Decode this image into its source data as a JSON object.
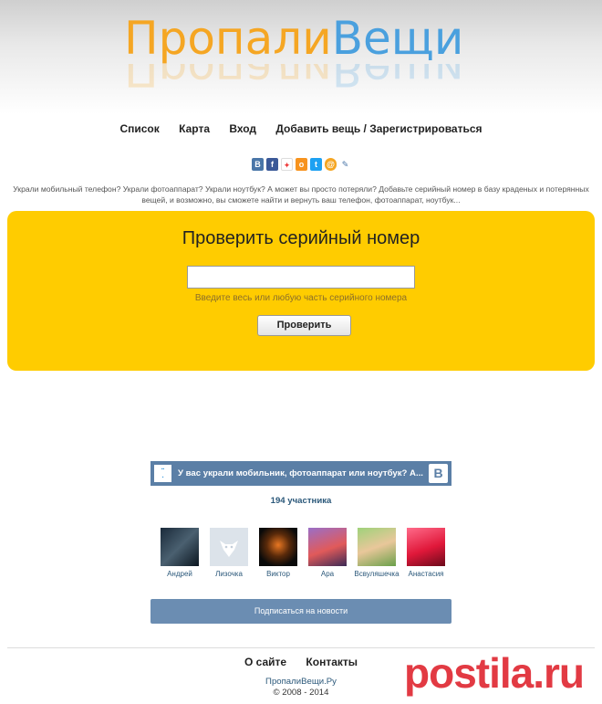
{
  "logo": {
    "part1": "Пропали",
    "part2": "Вещи"
  },
  "nav": {
    "list": "Список",
    "map": "Карта",
    "login": "Вход",
    "register": "Добавить вещь / Зарегистрироваться"
  },
  "share": {
    "icons": [
      "vk-icon",
      "facebook-icon",
      "odnoklassniki-icon",
      "livejournal-icon",
      "twitter-icon",
      "mailru-icon",
      "pencil-icon"
    ],
    "colors": [
      "#4a76a8",
      "#3b5998",
      "#f7931e",
      "#ee8208",
      "#1da1f2",
      "#168de2",
      "#7a9ec7"
    ]
  },
  "intro_text": "Украли мобильный телефон? Украли фотоаппарат? Украли ноутбук? А может вы просто потеряли? Добавьте серийный номер в базу краденых и потерянных вещей, и возможно, вы сможете найти и вернуть ваш телефон, фотоаппарат, ноутбук...",
  "check": {
    "title": "Проверить серийный номер",
    "input_value": "",
    "hint": "Введите весь или любую часть серийного номера",
    "button": "Проверить"
  },
  "vk_widget": {
    "title": "У вас украли мобильник, фотоаппарат или ноутбук? А...",
    "count": "194 участника",
    "members": [
      "Андрей",
      "Лизочка",
      "Виктор",
      "Ара",
      "Всвуляшечка",
      "Анастасия"
    ],
    "subscribe": "Подписаться на новости"
  },
  "footer": {
    "about": "О сайте",
    "contacts": "Контакты",
    "site": "ПропалиВещи.Ру",
    "copyright": "© 2008 - 2014"
  },
  "watermark": "postila.ru"
}
